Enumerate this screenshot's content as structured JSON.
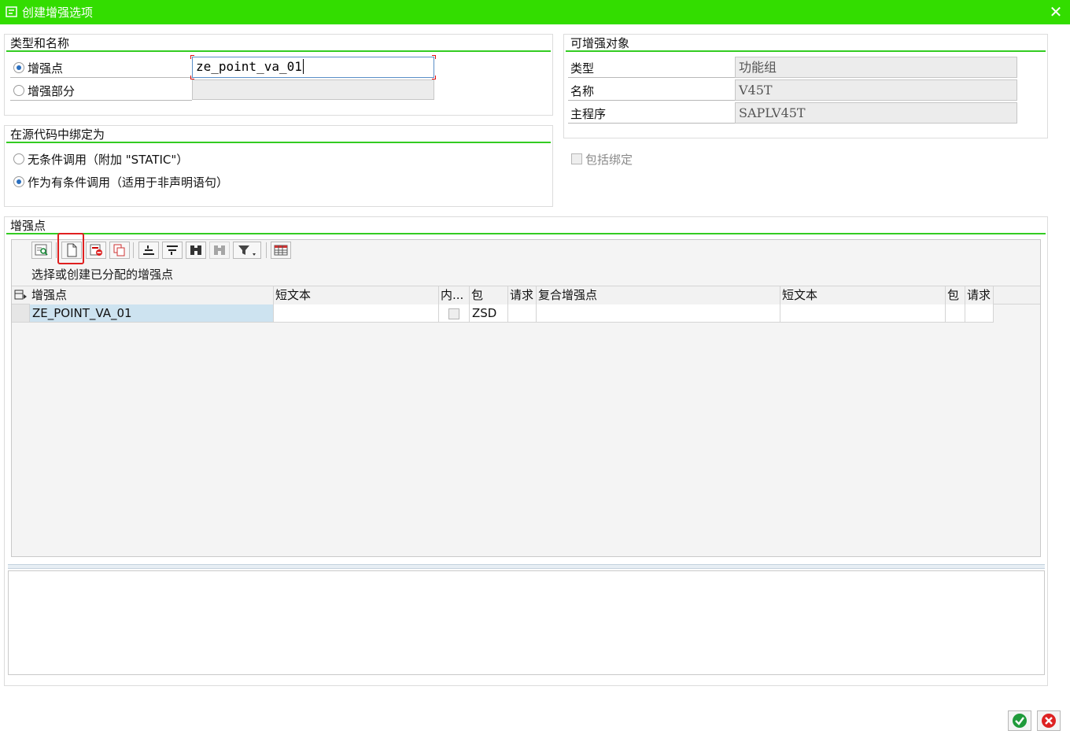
{
  "window": {
    "title": "创建增强选项"
  },
  "type_name": {
    "title": "类型和名称",
    "opt_point": "增强点",
    "opt_section": "增强部分",
    "point_value": "ze_point_va_01"
  },
  "binding": {
    "title": "在源代码中绑定为",
    "opt_static": "无条件调用（附加 \"STATIC\"）",
    "opt_conditional": "作为有条件调用（适用于非声明语句）"
  },
  "enhanceable": {
    "title": "可增强对象",
    "type_label": "类型",
    "type_value": "功能组",
    "name_label": "名称",
    "name_value": "V45T",
    "program_label": "主程序",
    "program_value": "SAPLV45T",
    "include_binding": "包括绑定"
  },
  "points": {
    "title": "增强点",
    "hint": "选择或创建已分配的增强点",
    "columns": [
      "增强点",
      "短文本",
      "内...",
      "包",
      "请求",
      "复合增强点",
      "短文本",
      "包",
      "请求"
    ],
    "rows": [
      {
        "point": "ZE_POINT_VA_01",
        "short_text": "",
        "package": "ZSD",
        "request": "",
        "composite": "",
        "short_text2": "",
        "package2": "",
        "request2": ""
      }
    ],
    "toolbar_icons": [
      "details-icon",
      "create-icon",
      "delete-icon",
      "copy-icon",
      "sort-ascending-icon",
      "sort-descending-icon",
      "find-icon",
      "find-next-icon",
      "filter-icon",
      "layout-grid-icon"
    ]
  },
  "colors": {
    "titlebar": "#33dd00",
    "group_line": "#33cc22",
    "selected_cell": "#cde3f0",
    "highlight_box": "#e02020"
  }
}
